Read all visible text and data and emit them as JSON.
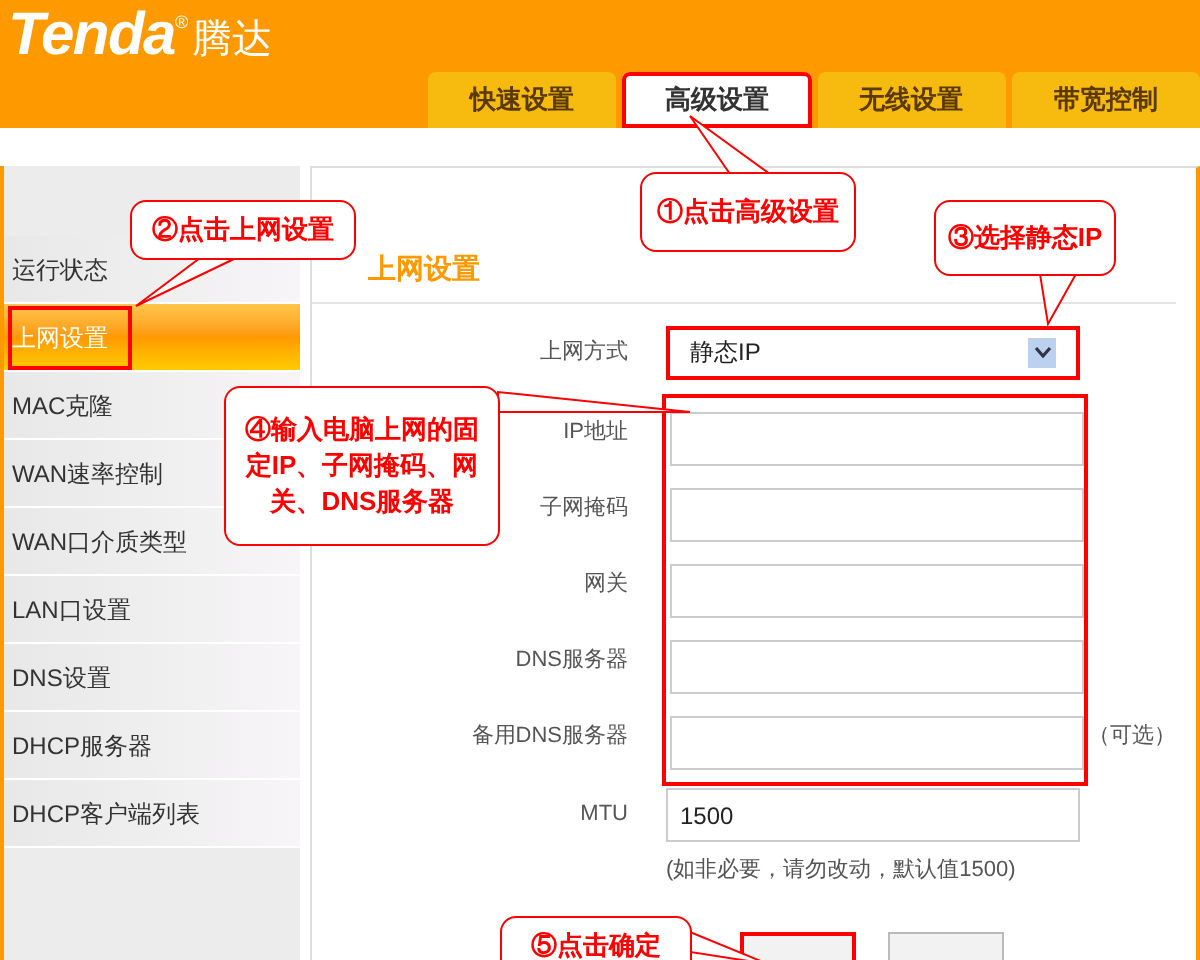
{
  "logo": {
    "brand": "Tenda",
    "mark": "®",
    "chinese": "腾达"
  },
  "tabs": [
    {
      "label": "快速设置",
      "selected": false,
      "highlighted": false
    },
    {
      "label": "高级设置",
      "selected": true,
      "highlighted": true
    },
    {
      "label": "无线设置",
      "selected": false,
      "highlighted": false
    },
    {
      "label": "带宽控制",
      "selected": false,
      "highlighted": false
    }
  ],
  "sidebar": {
    "items": [
      {
        "label": "运行状态",
        "selected": false,
        "highlighted": false
      },
      {
        "label": "上网设置",
        "selected": true,
        "highlighted": true
      },
      {
        "label": "MAC克隆",
        "selected": false,
        "highlighted": false
      },
      {
        "label": "WAN速率控制",
        "selected": false,
        "highlighted": false
      },
      {
        "label": "WAN口介质类型",
        "selected": false,
        "highlighted": false
      },
      {
        "label": "LAN口设置",
        "selected": false,
        "highlighted": false
      },
      {
        "label": "DNS设置",
        "selected": false,
        "highlighted": false
      },
      {
        "label": "DHCP服务器",
        "selected": false,
        "highlighted": false
      },
      {
        "label": "DHCP客户端列表",
        "selected": false,
        "highlighted": false
      }
    ]
  },
  "form": {
    "title": "上网设置",
    "connection_type": {
      "label": "上网方式",
      "value": "静态IP",
      "highlighted": true
    },
    "static_fields": {
      "highlighted": true,
      "rows": [
        {
          "label": "IP地址"
        },
        {
          "label": "子网掩码"
        },
        {
          "label": "网关"
        },
        {
          "label": "DNS服务器"
        },
        {
          "label": "备用DNS服务器",
          "note": "（可选）"
        }
      ]
    },
    "mtu": {
      "label": "MTU",
      "value": "1500",
      "hint": "(如非必要，请勿改动，默认值1500)"
    },
    "buttons": [
      {
        "highlighted": true
      },
      {
        "highlighted": false
      }
    ]
  },
  "callouts": [
    {
      "text": "①点击高级设置"
    },
    {
      "text": "②点击上网设置"
    },
    {
      "text": "③选择静态IP"
    },
    {
      "text": "④输入电脑上网的固定IP、子网掩码、网关、DNS服务器"
    },
    {
      "text": "⑤点击确定"
    }
  ]
}
